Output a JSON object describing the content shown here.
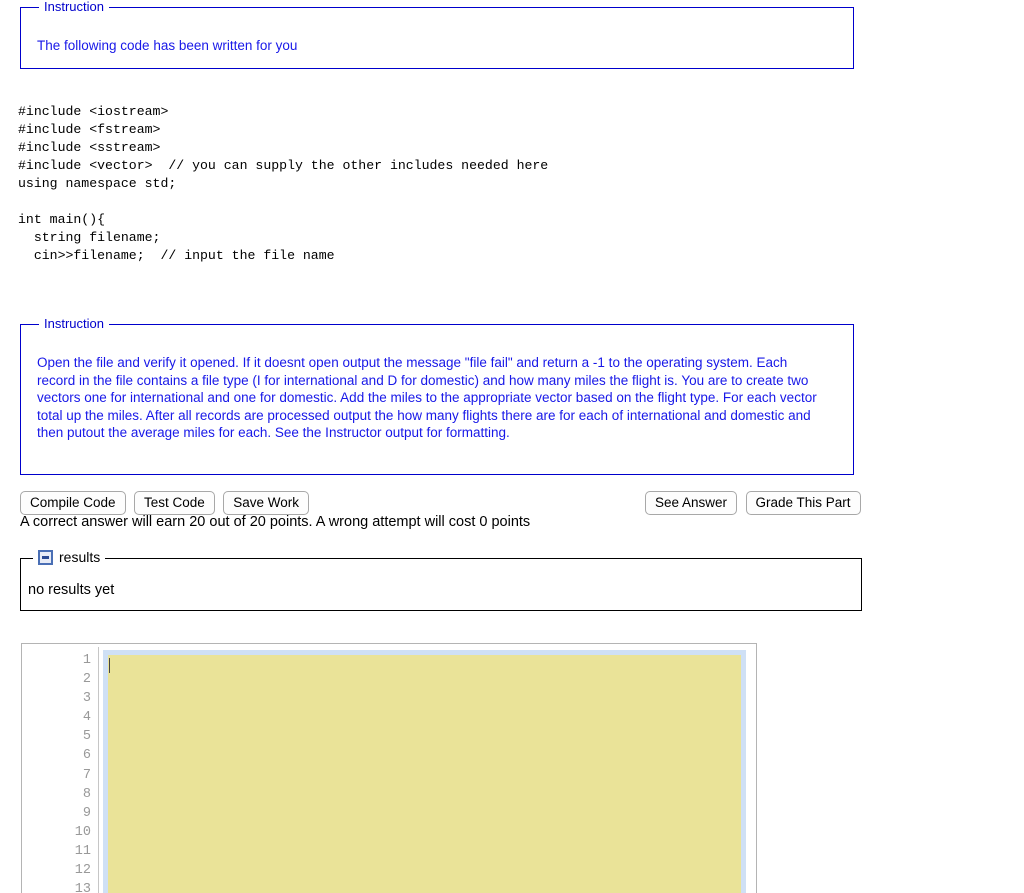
{
  "instruction_1": {
    "legend": "Instruction",
    "text": "The following code has been written for you"
  },
  "code_listing": "#include <iostream>\n#include <fstream>\n#include <sstream>\n#include <vector>  // you can supply the other includes needed here\nusing namespace std;\n\nint main(){\n  string filename;\n  cin>>filename;  // input the file name",
  "instruction_2": {
    "legend": "Instruction",
    "text": "Open the file and verify it opened. If it doesnt open output the message \"file fail\" and return a -1 to the operating system. Each record in the file contains a file type (I for international and D for domestic) and how many miles the flight is. You are to create two vectors one for international and one for domestic. Add the miles to the appropriate vector based on the flight type. For each vector total up the miles. After all records are processed output the how many flights there are for each of international and domestic and then putout the average miles for each. See the Instructor output for formatting."
  },
  "toolbar": {
    "compile_code_label": "Compile Code",
    "test_code_label": "Test Code",
    "save_work_label": "Save Work",
    "see_answer_label": "See Answer",
    "grade_this_part_label": "Grade This Part"
  },
  "points_note": "A correct answer will earn 20 out of 20 points. A wrong attempt will cost 0 points",
  "results": {
    "toggle_icon": "minus-square-icon",
    "legend": "results",
    "content": "no results yet"
  },
  "editor": {
    "line_numbers": [
      "1",
      "2",
      "3",
      "4",
      "5",
      "6",
      "7",
      "8",
      "9",
      "10",
      "11",
      "12",
      "13"
    ],
    "content": "",
    "background_color": "#eae398",
    "selection_border_color": "#cfe0f5"
  }
}
